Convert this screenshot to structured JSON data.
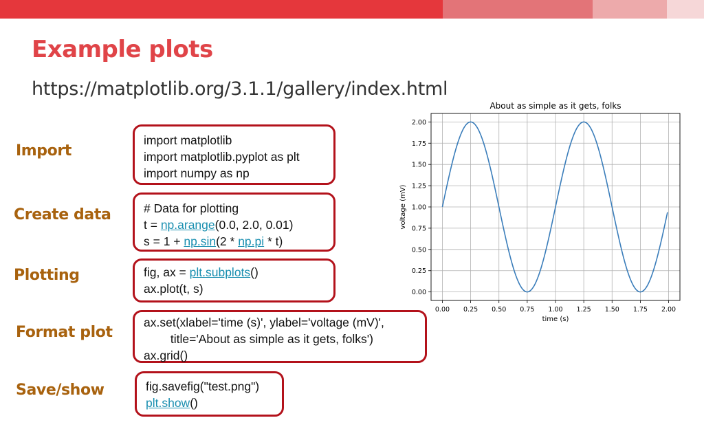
{
  "slide": {
    "title": "Example plots",
    "url": "https://matplotlib.org/3.1.1/gallery/index.html"
  },
  "colors": {
    "title": "#e04448",
    "step_label": "#a8620e",
    "box_border": "#b3121b",
    "link": "#1a8fb0",
    "top_bar": [
      "#e5373c",
      "#e37478",
      "#edaaab",
      "#f6d7d8"
    ],
    "line": "#3a7dba",
    "grid": "#b0b0b0"
  },
  "steps": [
    {
      "label": "Import",
      "code": [
        [
          {
            "t": "import matplotlib"
          }
        ],
        [
          {
            "t": "import matplotlib.pyplot as plt"
          }
        ],
        [
          {
            "t": "import numpy as np"
          }
        ]
      ]
    },
    {
      "label": "Create data",
      "code": [
        [
          {
            "t": "# Data for plotting"
          }
        ],
        [
          {
            "t": "t = "
          },
          {
            "t": "np.arange",
            "link": true
          },
          {
            "t": "(0.0, 2.0, 0.01)"
          }
        ],
        [
          {
            "t": "s = 1 + "
          },
          {
            "t": "np.sin",
            "link": true
          },
          {
            "t": "(2 * "
          },
          {
            "t": "np.pi",
            "link": true
          },
          {
            "t": " * t)"
          }
        ]
      ]
    },
    {
      "label": "Plotting",
      "code": [
        [
          {
            "t": "fig, ax = "
          },
          {
            "t": "plt.subplots",
            "link": true
          },
          {
            "t": "()"
          }
        ],
        [
          {
            "t": "ax.plot(t, s)"
          }
        ]
      ]
    },
    {
      "label": "Format plot",
      "code": [
        [
          {
            "t": "ax.set(xlabel='time (s)', ylabel='voltage (mV)',"
          }
        ],
        [
          {
            "t": "        title='About as simple as it gets, folks')"
          }
        ],
        [
          {
            "t": "ax.grid()"
          }
        ]
      ]
    },
    {
      "label": "Save/show",
      "code": [
        [
          {
            "t": "fig.savefig(\"test.png\")"
          }
        ],
        [
          {
            "t": "plt.show",
            "link": true
          },
          {
            "t": "()"
          }
        ]
      ]
    }
  ],
  "chart_data": {
    "type": "line",
    "title": "About as simple as it gets, folks",
    "xlabel": "time (s)",
    "ylabel": "voltage (mV)",
    "function": "s = 1 + sin(2*pi*t)",
    "x_start": 0.0,
    "x_stop": 2.0,
    "x_step": 0.01,
    "xlim": [
      -0.1,
      2.1
    ],
    "ylim": [
      -0.1,
      2.1
    ],
    "xticks": [
      0.0,
      0.25,
      0.5,
      0.75,
      1.0,
      1.25,
      1.5,
      1.75,
      2.0
    ],
    "xtick_labels": [
      "0.00",
      "0.25",
      "0.50",
      "0.75",
      "1.00",
      "1.25",
      "1.50",
      "1.75",
      "2.00"
    ],
    "yticks": [
      0.0,
      0.25,
      0.5,
      0.75,
      1.0,
      1.25,
      1.5,
      1.75,
      2.0
    ],
    "ytick_labels": [
      "0.00",
      "0.25",
      "0.50",
      "0.75",
      "1.00",
      "1.25",
      "1.50",
      "1.75",
      "2.00"
    ],
    "grid": true
  }
}
